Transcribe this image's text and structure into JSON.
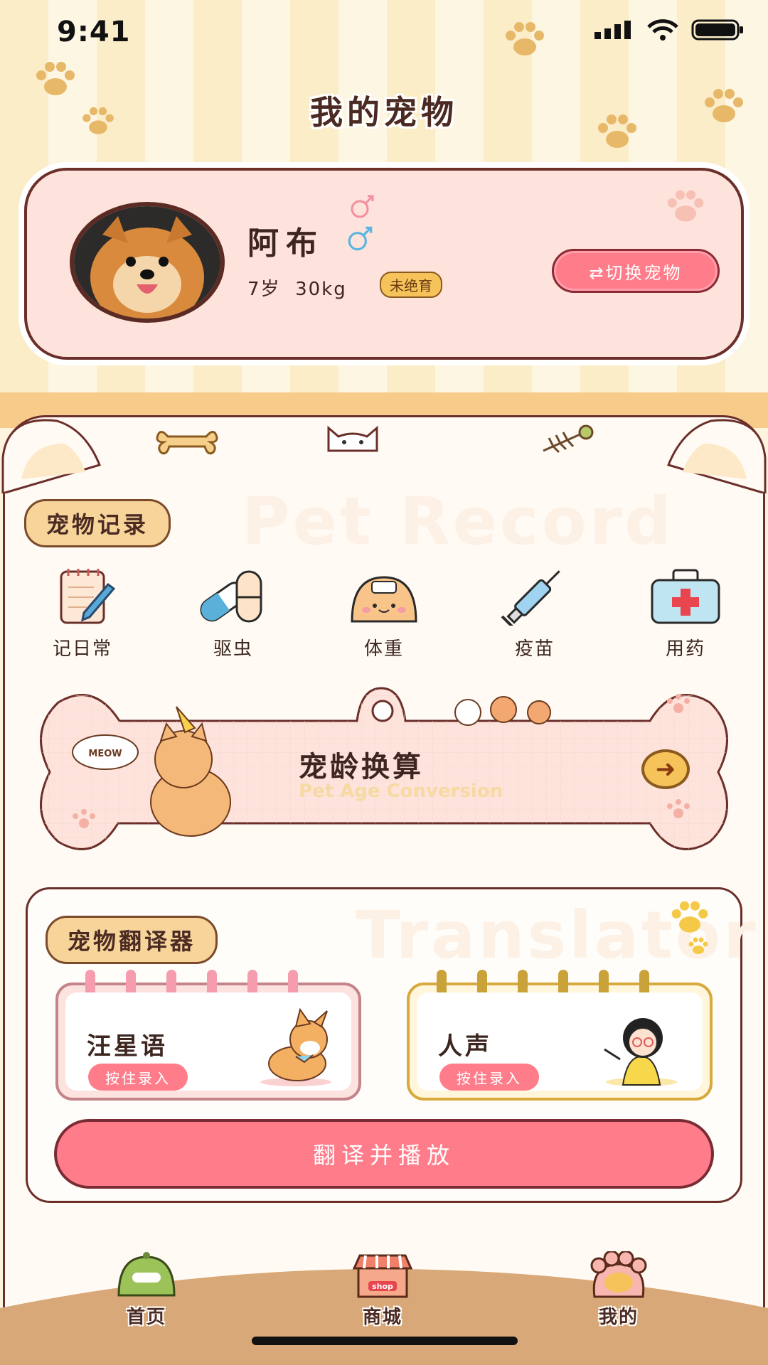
{
  "status": {
    "time": "9:41"
  },
  "header": {
    "title": "我的宠物"
  },
  "pet": {
    "name": "阿布",
    "age": "7岁",
    "weight": "30kg",
    "badge": "未绝育",
    "switch_label": "⇄切换宠物"
  },
  "records": {
    "section_label": "宠物记录",
    "watermark": "Pet Record",
    "items": [
      {
        "label": "记日常",
        "icon": "notebook-icon"
      },
      {
        "label": "驱虫",
        "icon": "capsule-icon"
      },
      {
        "label": "体重",
        "icon": "scale-icon"
      },
      {
        "label": "疫苗",
        "icon": "syringe-icon"
      },
      {
        "label": "用药",
        "icon": "medkit-icon"
      }
    ]
  },
  "age_conversion": {
    "title": "宠龄换算",
    "subtitle": "Pet Age Conversion",
    "cat_bubble": "MEOW"
  },
  "translator": {
    "section_label": "宠物翻译器",
    "watermark": "Translator",
    "pet_card": {
      "title": "汪星语",
      "button": "按住录入"
    },
    "human_card": {
      "title": "人声",
      "button": "按住录入"
    },
    "play_label": "翻译并播放"
  },
  "tabs": [
    {
      "label": "首页",
      "icon": "home-icon"
    },
    {
      "label": "商城",
      "icon": "shop-icon",
      "sign": "shop"
    },
    {
      "label": "我的",
      "icon": "paw-icon"
    }
  ],
  "colors": {
    "accent": "#ff7d8a",
    "outline": "#6b2f2a",
    "badge": "#f6c35a"
  }
}
